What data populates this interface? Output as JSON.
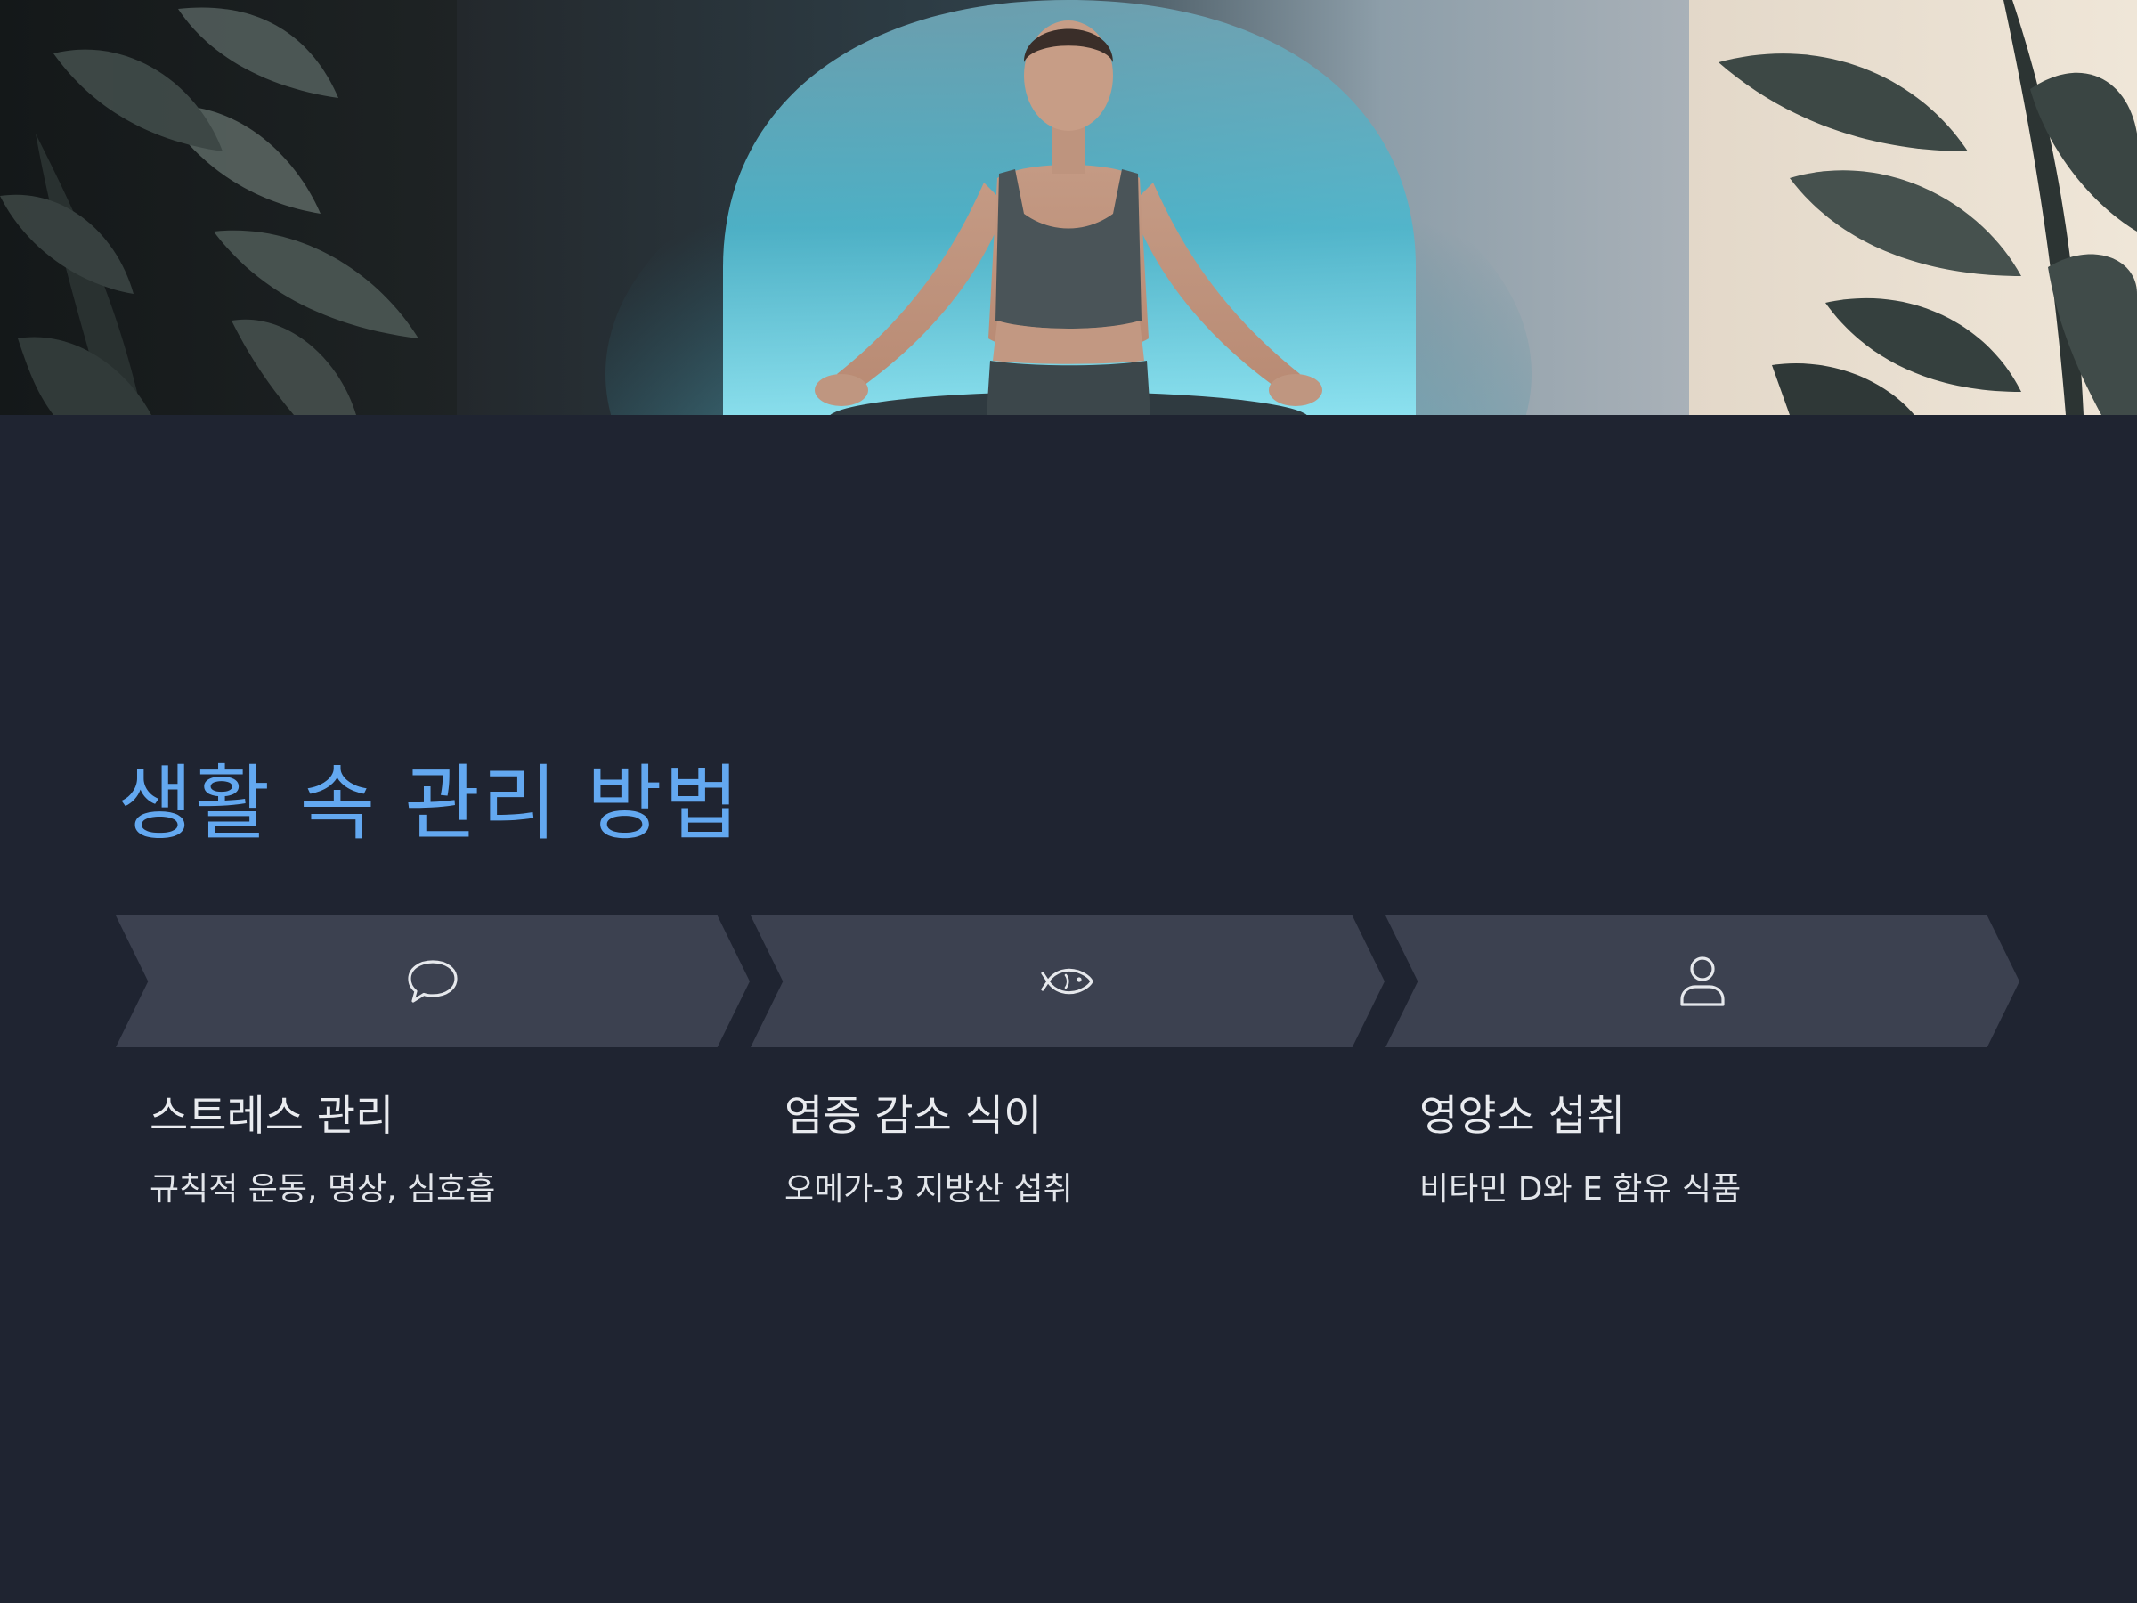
{
  "section": {
    "title": "생활 속 관리 방법"
  },
  "steps": [
    {
      "icon": "speech-bubble-icon",
      "title": "스트레스 관리",
      "description": "규칙적 운동, 명상, 심호흡"
    },
    {
      "icon": "fish-icon",
      "title": "염증 감소 식이",
      "description": "오메가-3 지방산 섭취"
    },
    {
      "icon": "person-icon",
      "title": "영양소 섭취",
      "description": "비타민 D와 E 함유 식품"
    }
  ],
  "colors": {
    "background": "#1f2431",
    "accent": "#63a8f0",
    "chevron": "#3c4150",
    "text": "#e9ebef"
  }
}
